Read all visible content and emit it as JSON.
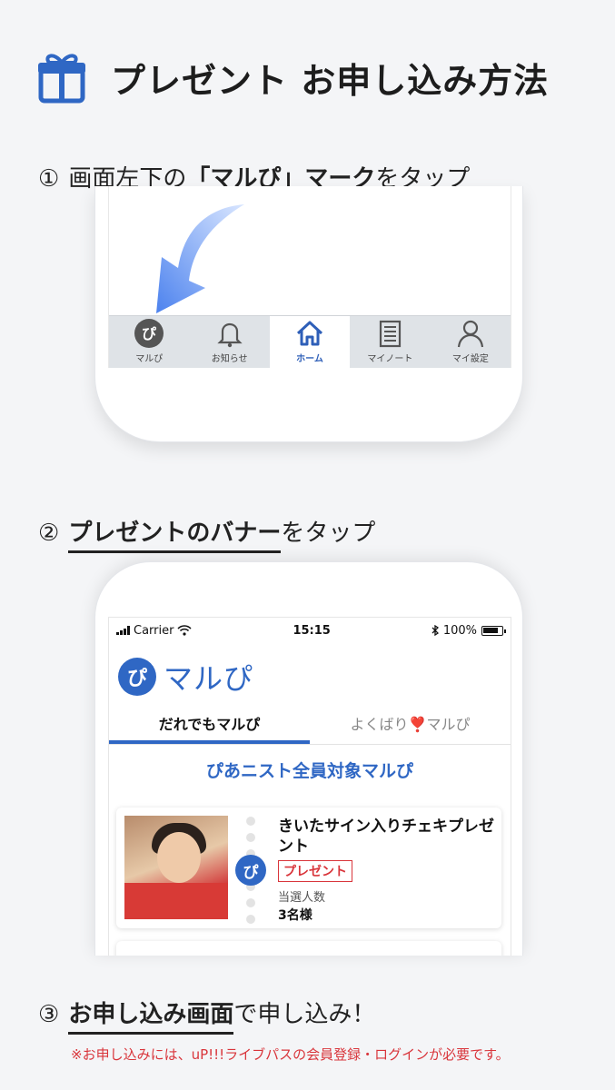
{
  "header": {
    "title": "プレゼント お申し込み方法",
    "icon": "gift-icon"
  },
  "steps": [
    {
      "number": "①",
      "prefix": "画面左下の",
      "highlight": "「マルぴ」マーク",
      "suffix": "をタップ"
    },
    {
      "number": "②",
      "prefix": "",
      "highlight": "プレゼントのバナー",
      "suffix": "をタップ"
    },
    {
      "number": "③",
      "prefix": "",
      "highlight": "お申し込み画面",
      "suffix": "で申し込み！"
    }
  ],
  "tabbar": {
    "items": [
      {
        "label": "マルぴ",
        "icon": "marupi-icon"
      },
      {
        "label": "お知らせ",
        "icon": "bell-icon"
      },
      {
        "label": "ホーム",
        "icon": "home-icon"
      },
      {
        "label": "マイノート",
        "icon": "notebook-icon"
      },
      {
        "label": "マイ設定",
        "icon": "user-icon"
      }
    ]
  },
  "status_bar": {
    "carrier": "Carrier",
    "time": "15:15",
    "battery": "100%"
  },
  "app": {
    "brand_name": "マルぴ",
    "tabs": [
      {
        "label": "だれでもマルぴ"
      },
      {
        "label": "よくばり❣️マルぴ"
      }
    ],
    "section_title": "ぴあニスト全員対象マルぴ",
    "card": {
      "title": "きいたサイン入りチェキプレゼント",
      "tag": "プレゼント",
      "meta_label": "当選人数",
      "meta_value": "3名様"
    }
  },
  "note": "※お申し込みには、uP!!!ライブパスの会員登録・ログインが必要です。",
  "colors": {
    "accent": "#2f67c4",
    "warning": "#d9353b",
    "background": "#f4f5f7"
  }
}
